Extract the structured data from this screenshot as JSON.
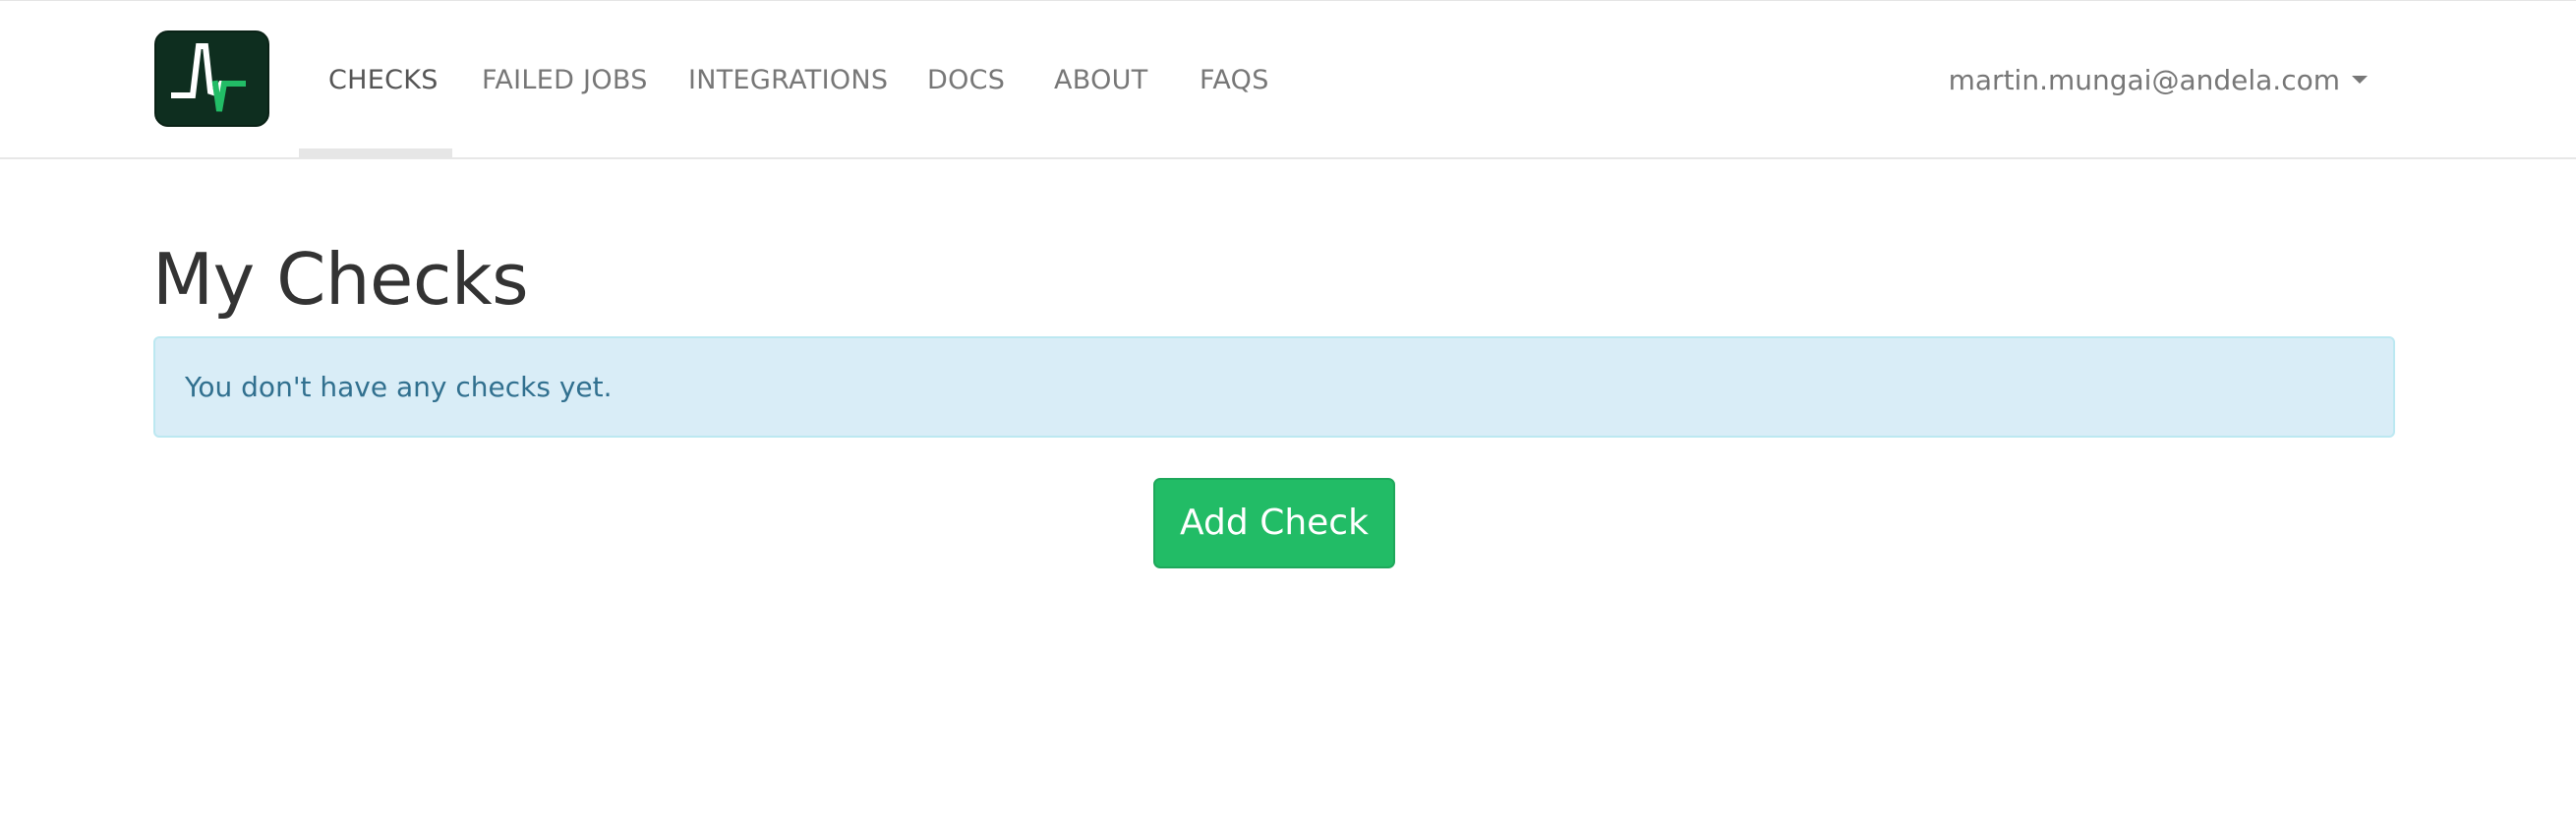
{
  "nav": {
    "items": [
      {
        "label": "CHECKS",
        "active": true
      },
      {
        "label": "FAILED JOBS",
        "active": false
      },
      {
        "label": "INTEGRATIONS",
        "active": false
      },
      {
        "label": "DOCS",
        "active": false
      },
      {
        "label": "ABOUT",
        "active": false
      },
      {
        "label": "FAQS",
        "active": false
      }
    ],
    "user_email": "martin.mungai@andela.com",
    "logo_icon": "pulse-logo-icon",
    "user_menu_icon": "caret-down-icon"
  },
  "main": {
    "title": "My Checks",
    "empty_message": "You don't have any checks yet.",
    "add_button_label": "Add Check"
  },
  "colors": {
    "accent": "#22bc66",
    "alert_bg": "#d9edf7",
    "alert_text": "#31708f",
    "logo_bg": "#0e2e1f"
  }
}
